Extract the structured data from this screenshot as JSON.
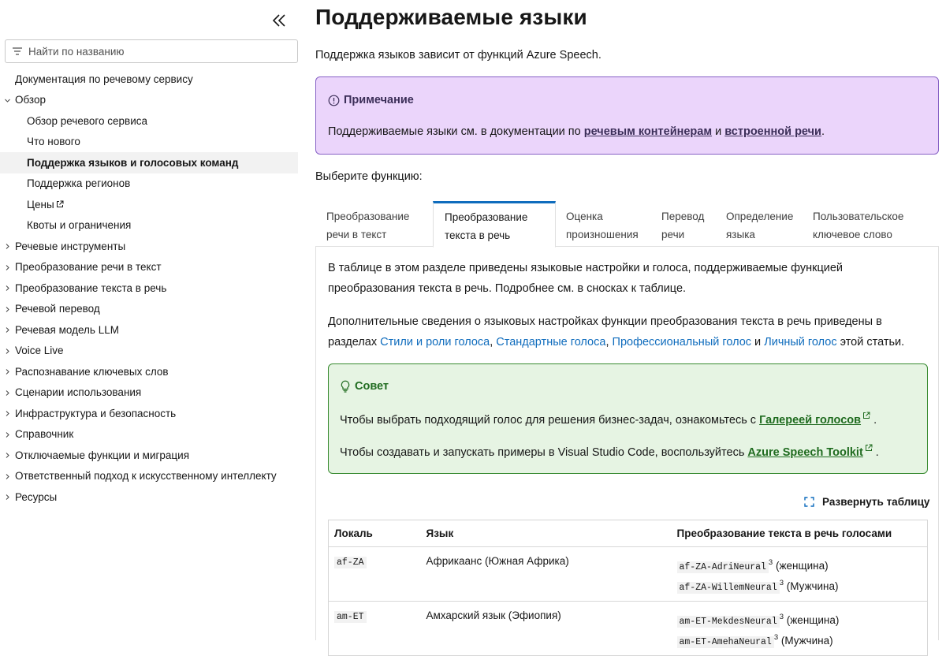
{
  "sidebar": {
    "search_placeholder": "Найти по названию",
    "items": [
      {
        "label": "Документация по речевому сервису",
        "level": "top",
        "expandable": false
      },
      {
        "label": "Обзор",
        "level": "top",
        "expandable": true,
        "expanded": true
      },
      {
        "label": "Обзор речевого сервиса",
        "level": "sub"
      },
      {
        "label": "Что нового",
        "level": "sub"
      },
      {
        "label": "Поддержка языков и голосовых команд",
        "level": "sub",
        "active": true
      },
      {
        "label": "Поддержка регионов",
        "level": "sub"
      },
      {
        "label": "Цены",
        "level": "sub",
        "external": true
      },
      {
        "label": "Квоты и ограничения",
        "level": "sub"
      },
      {
        "label": "Речевые инструменты",
        "level": "top",
        "expandable": true
      },
      {
        "label": "Преобразование речи в текст",
        "level": "top",
        "expandable": true
      },
      {
        "label": "Преобразование текста в речь",
        "level": "top",
        "expandable": true
      },
      {
        "label": "Речевой перевод",
        "level": "top",
        "expandable": true
      },
      {
        "label": "Речевая модель LLM",
        "level": "top",
        "expandable": true
      },
      {
        "label": "Voice Live",
        "level": "top",
        "expandable": true
      },
      {
        "label": "Распознавание ключевых слов",
        "level": "top",
        "expandable": true
      },
      {
        "label": "Сценарии использования",
        "level": "top",
        "expandable": true
      },
      {
        "label": "Инфраструктура и безопасность",
        "level": "top",
        "expandable": true
      },
      {
        "label": "Справочник",
        "level": "top",
        "expandable": true
      },
      {
        "label": "Отключаемые функции и миграция",
        "level": "top",
        "expandable": true
      },
      {
        "label": "Ответственный подход к искусственному интеллекту",
        "level": "top",
        "expandable": true
      },
      {
        "label": "Ресурсы",
        "level": "top",
        "expandable": true
      }
    ]
  },
  "main": {
    "title": "Поддерживаемые языки",
    "intro": "Поддержка языков зависит от функций Azure Speech.",
    "note": {
      "title": "Примечание",
      "text_before": "Поддерживаемые языки см. в документации по ",
      "link1": "речевым контейнерам",
      "text_mid": " и ",
      "link2": "встроенной речи",
      "text_after": "."
    },
    "choose_label": "Выберите функцию:",
    "tabs": [
      {
        "line1": "Преобразование",
        "line2": "речи в текст"
      },
      {
        "line1": "Преобразование",
        "line2": "текста в речь",
        "active": true
      },
      {
        "line1": "Оценка",
        "line2": "произношения"
      },
      {
        "line1": "Перевод",
        "line2": "речи"
      },
      {
        "line1": "Определение",
        "line2": "языка"
      },
      {
        "line1": "Пользовательское",
        "line2": "ключевое слово"
      }
    ],
    "panel": {
      "p1": "В таблице в этом разделе приведены языковые настройки и голоса, поддерживаемые функцией преобразования текста в речь. Подробнее см. в сносках к таблице.",
      "p2_before": "Дополнительные сведения о языковых настройках функции преобразования текста в речь приведены в разделах ",
      "p2_link1": "Стили и роли голоса",
      "p2_sep1": ", ",
      "p2_link2": "Стандартные голоса",
      "p2_sep2": ", ",
      "p2_link3": "Профессиональный голос",
      "p2_sep3": " и ",
      "p2_link4": "Личный голос",
      "p2_after": " этой статьи.",
      "tip": {
        "title": "Совет",
        "line1_before": "Чтобы выбрать подходящий голос для решения бизнес-задач, ознакомьтесь с ",
        "line1_link": "Галереей голосов",
        "line1_after": " .",
        "line2_before": "Чтобы создавать и запускать примеры в Visual Studio Code, воспользуйтесь ",
        "line2_link": "Azure Speech Toolkit",
        "line2_after": " ."
      },
      "expand_label": "Развернуть таблицу",
      "table": {
        "headers": [
          "Локаль",
          "Язык",
          "Преобразование текста в речь голосами"
        ],
        "rows": [
          {
            "locale": "af-ZA",
            "language": "Африкаанс (Южная Африка)",
            "v1": "af-ZA-AdriNeural",
            "v1_sup": "3",
            "v1_gender": " (женщина)",
            "v2": "af-ZA-WillemNeural",
            "v2_sup": "3",
            "v2_gender": " (Мужчина)"
          },
          {
            "locale": "am-ET",
            "language": "Амхарский язык (Эфиопия)",
            "v1": "am-ET-MekdesNeural",
            "v1_sup": "3",
            "v1_gender": " (женщина)",
            "v2": "am-ET-AmehaNeural",
            "v2_sup": "3",
            "v2_gender": " (Мужчина)"
          }
        ]
      }
    }
  },
  "colors": {
    "note_bg": "#ebd5fb",
    "note_border": "#8661c5",
    "tip_bg": "#e6f4e3",
    "tip_border": "#378a2f",
    "link": "#0f6cbd",
    "tab_active": "#0f6cbd"
  },
  "icons": {
    "collapse": "double-chevron-left-icon",
    "search": "filter-icon",
    "note": "info-icon",
    "tip": "lightbulb-icon",
    "expand": "expand-icon",
    "external": "external-link-icon"
  }
}
